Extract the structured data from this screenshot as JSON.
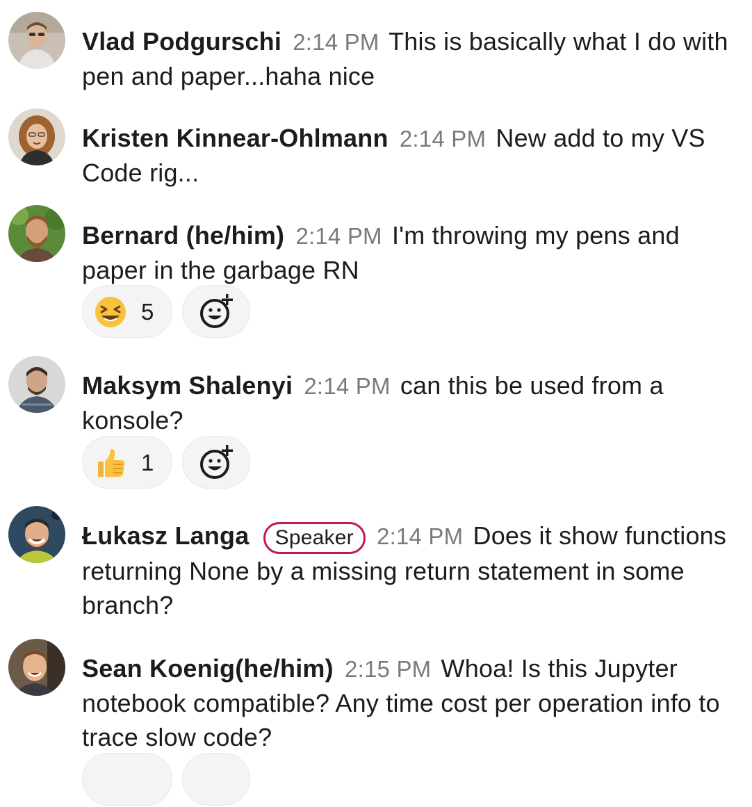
{
  "messages": [
    {
      "name": "Vlad Podgurschi",
      "time": "2:14 PM",
      "text": "This is basically what I do with pen and paper...haha nice"
    },
    {
      "name": "Kristen Kinnear-Ohlmann",
      "time": "2:14 PM",
      "text": "New add to my VS Code rig..."
    },
    {
      "name": "Bernard (he/him)",
      "time": "2:14 PM",
      "text": "I'm throwing my pens and paper in the garbage RN",
      "reaction": {
        "emoji": "laughing-face-icon",
        "count": "5"
      }
    },
    {
      "name": "Maksym Shalenyi",
      "time": "2:14 PM",
      "text": "can this be used from a konsole?",
      "reaction": {
        "emoji": "thumbs-up-icon",
        "count": "1"
      }
    },
    {
      "name": "Łukasz Langa",
      "badge": "Speaker",
      "time": "2:14 PM",
      "text": "Does it show functions returning None by a missing return statement in some branch?"
    },
    {
      "name": "Sean Koenig(he/him)",
      "time": "2:15 PM",
      "text": "Whoa! Is this Jupyter notebook compatible? Any time cost per operation info to trace slow code?"
    }
  ],
  "colors": {
    "badge_border": "#c2185b",
    "timestamp": "#7a7a7a",
    "reaction_bg": "#f4f4f4"
  }
}
